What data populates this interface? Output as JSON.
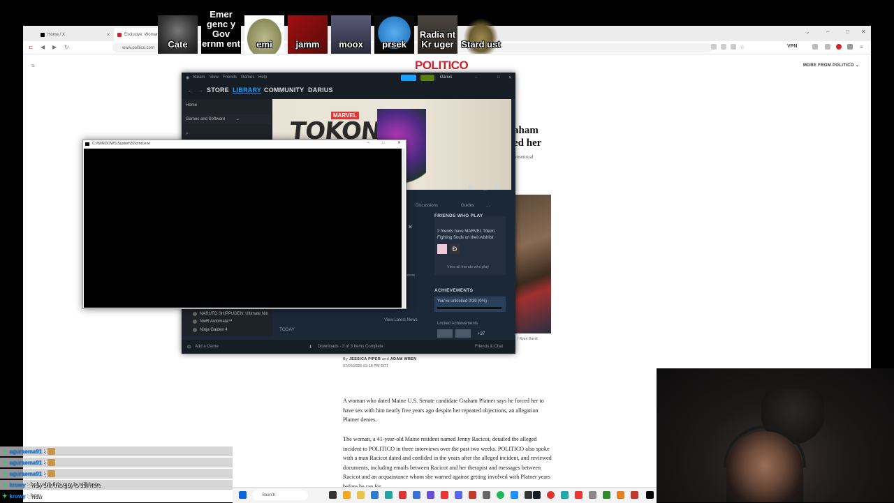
{
  "browser": {
    "tabs": [
      {
        "label": "Home / X"
      },
      {
        "label": "Exclusive: Woman w"
      }
    ],
    "url": "www.politico.com",
    "vpn_label": "VPN"
  },
  "page": {
    "logo": "POLITICO",
    "more_from": "MORE FROM POLITICO",
    "headline_lines": [
      "aham",
      "ed her"
    ],
    "subhead": "onsensual",
    "photo_credit": "| Ryan David",
    "byline_prefix": "By",
    "author1": "JESSICA PIPER",
    "byline_and": "and",
    "author2": "ADAM WREN",
    "date": "07/06/2026 03:18 PM EDT",
    "paragraphs": [
      "A woman who dated Maine U.S. Senate candidate Graham Platner says he forced her to have sex with him nearly five years ago despite her repeated objections, an allegation Platner denies.",
      "The woman, a 41-year-old Maine resident named Jenny Racicot, detailed the alleged incident to POLITICO in three interviews over the past two weeks. POLITICO also spoke with a man Racicot dated and confided in the years after the alleged incident, and reviewed documents, including emails between Racicot and her therapist and messages between Racicot and an acquaintance whom she warned against getting involved with Platner years before he ran for"
    ]
  },
  "overlay_avatars": [
    {
      "name": "Cate",
      "color": "#2a2a2a"
    },
    {
      "name": "Emergency Government",
      "display": "Emer genc y Gov ernm ent",
      "color": "#000000"
    },
    {
      "name": "emi",
      "color": "#8a8a5a"
    },
    {
      "name": "jamm",
      "color": "#8b1a1a"
    },
    {
      "name": "moox",
      "color": "#3a3a5a"
    },
    {
      "name": "prsek",
      "color": "#3a8fd8"
    },
    {
      "name": "Radiant Kruger",
      "display": "Radia nt Kr uger",
      "color": "#3a3530"
    },
    {
      "name": "Stardust",
      "display": "Stard ust",
      "color": "#d8d0b0"
    }
  ],
  "steam": {
    "title_app": "Steam",
    "menu": [
      "View",
      "Friends",
      "Games",
      "Help"
    ],
    "nav": [
      "STORE",
      "LIBRARY",
      "COMMUNITY",
      "DARIUS"
    ],
    "user": "Darius",
    "side_home": "Home",
    "side_filter": "Games and Software",
    "hero_title": "TOKON",
    "hero_brand": "MARVEL",
    "tabs": [
      "Discussions",
      "Guides",
      "..."
    ],
    "friends_heading": "FRIENDS WHO PLAY",
    "friends_text": "2 friends have MARVEL Tōkon: Fighting Souls on their wishlist",
    "friends_link": "View all friends who play",
    "achievements_heading": "ACHIEVEMENTS",
    "achievements_text": "You've unlocked 0/39 (0%)",
    "locked_heading": "Locked Achievements",
    "locked_more": "+37",
    "news_link": "View Latest News",
    "today": "TODAY",
    "store_label": "store",
    "games": [
      "NARUTO SHIPPUDEN: Ultimate Nin",
      "NieR:Automata™",
      "Ninja Gaiden 4"
    ],
    "add_game": "Add a Game",
    "downloads": "Downloads - 3 of 3 Items Complete",
    "friends_chat": "Friends & Chat"
  },
  "cmd": {
    "title": "C:\\WINDOWS\\System32\\cmd.exe"
  },
  "taskbar": {
    "search_placeholder": "Search"
  },
  "chat": [
    {
      "user": "aguraema91",
      "sep": ":",
      "msg": ""
    },
    {
      "user": "aguraema91",
      "sep": ":",
      "msg": ""
    },
    {
      "user": "aguraema91",
      "sep": ":",
      "msg": ""
    },
    {
      "user": "krowy",
      "sep": ":",
      "msg": "holy shit this guy is still here"
    },
    {
      "user": "krowy",
      "sep": ":",
      "msg": "how"
    }
  ]
}
